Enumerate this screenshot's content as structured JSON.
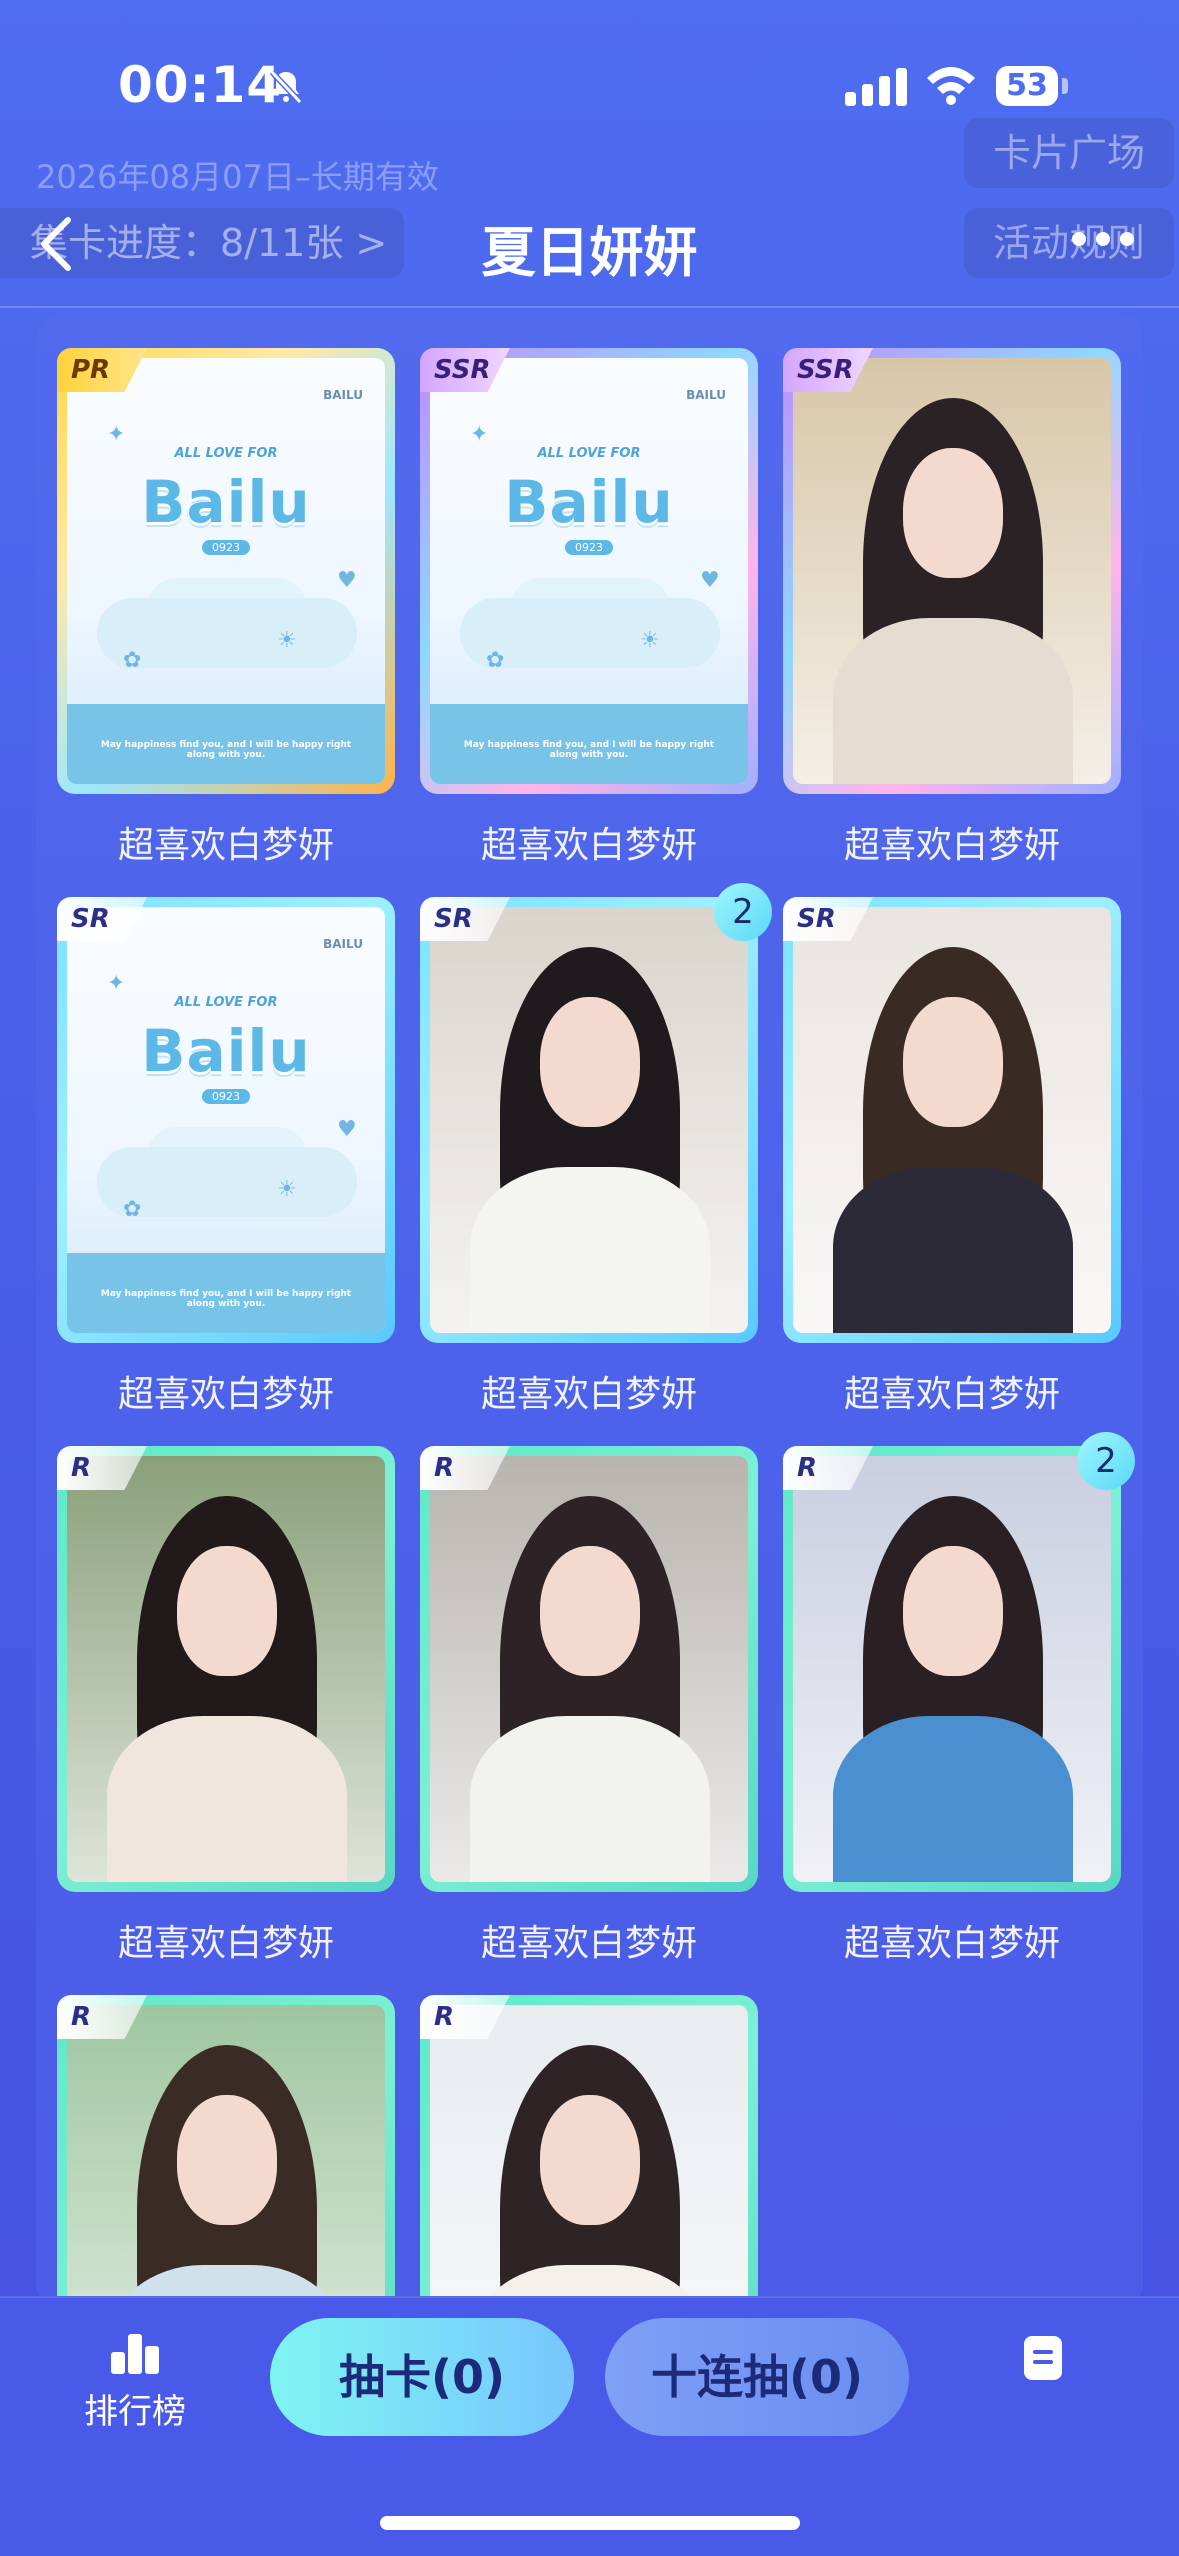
{
  "status": {
    "time": "00:14",
    "battery": "53"
  },
  "header": {
    "validity": "2026年08月07日–长期有效",
    "card_plaza": "卡片广场",
    "rules": "活动规则",
    "progress": "集卡进度：8/11张 >",
    "title": "夏日妍妍"
  },
  "cards": [
    {
      "rarity": "PR",
      "name": "超喜欢白梦妍",
      "art": "logo",
      "count": ""
    },
    {
      "rarity": "SSR",
      "name": "超喜欢白梦妍",
      "art": "logo",
      "count": ""
    },
    {
      "rarity": "SSR",
      "name": "超喜欢白梦妍",
      "art": "photo",
      "count": ""
    },
    {
      "rarity": "SR",
      "name": "超喜欢白梦妍",
      "art": "logo",
      "count": ""
    },
    {
      "rarity": "SR",
      "name": "超喜欢白梦妍",
      "art": "photo",
      "count": "2"
    },
    {
      "rarity": "SR",
      "name": "超喜欢白梦妍",
      "art": "photo",
      "count": ""
    },
    {
      "rarity": "R",
      "name": "超喜欢白梦妍",
      "art": "photo",
      "count": ""
    },
    {
      "rarity": "R",
      "name": "超喜欢白梦妍",
      "art": "photo",
      "count": ""
    },
    {
      "rarity": "R",
      "name": "超喜欢白梦妍",
      "art": "photo",
      "count": "2"
    },
    {
      "rarity": "R",
      "name": "",
      "art": "photo",
      "count": ""
    },
    {
      "rarity": "R",
      "name": "",
      "art": "photo",
      "count": ""
    }
  ],
  "logo_art": {
    "top": "ALL LOVE FOR",
    "main": "Bailu",
    "num": "0923",
    "mini": "BAILU",
    "caption": "May happiness find you, and I will be happy right along with you."
  },
  "bottom": {
    "rank_label": "排行榜",
    "draw_button": "抽卡(0)",
    "ten_draw_button": "十连抽(0)"
  },
  "colors": {
    "background": "#4f6df0",
    "accent": "#7ef5f0"
  }
}
